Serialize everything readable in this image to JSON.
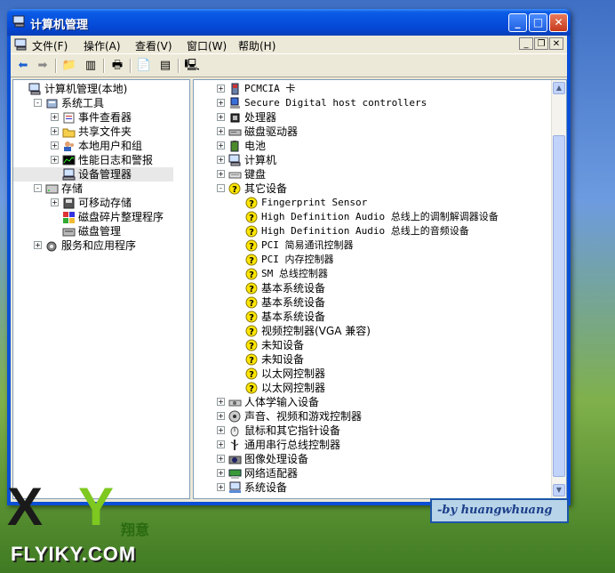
{
  "window": {
    "title": "计算机管理"
  },
  "menubar": [
    {
      "label": "文件(F)"
    },
    {
      "label": "操作(A)"
    },
    {
      "label": "查看(V)"
    },
    {
      "label": "窗口(W)"
    },
    {
      "label": "帮助(H)"
    }
  ],
  "left_tree": [
    {
      "label": "计算机管理(本地)",
      "level": 0,
      "expander": "",
      "icon": "computer-icon"
    },
    {
      "label": "系统工具",
      "level": 1,
      "expander": "-",
      "icon": "tools-icon"
    },
    {
      "label": "事件查看器",
      "level": 2,
      "expander": "+",
      "icon": "event-viewer-icon"
    },
    {
      "label": "共享文件夹",
      "level": 2,
      "expander": "+",
      "icon": "shared-folder-icon"
    },
    {
      "label": "本地用户和组",
      "level": 2,
      "expander": "+",
      "icon": "users-icon"
    },
    {
      "label": "性能日志和警报",
      "level": 2,
      "expander": "+",
      "icon": "performance-icon"
    },
    {
      "label": "设备管理器",
      "level": 2,
      "expander": "",
      "icon": "device-manager-icon",
      "selected": true
    },
    {
      "label": "存储",
      "level": 1,
      "expander": "-",
      "icon": "storage-icon"
    },
    {
      "label": "可移动存储",
      "level": 2,
      "expander": "+",
      "icon": "removable-storage-icon"
    },
    {
      "label": "磁盘碎片整理程序",
      "level": 2,
      "expander": "",
      "icon": "defrag-icon"
    },
    {
      "label": "磁盘管理",
      "level": 2,
      "expander": "",
      "icon": "disk-management-icon"
    },
    {
      "label": "服务和应用程序",
      "level": 1,
      "expander": "+",
      "icon": "services-icon"
    }
  ],
  "device_tree": [
    {
      "label": "PCMCIA 卡",
      "level": 0,
      "expander": "+",
      "icon": "pcmcia-icon"
    },
    {
      "label": "Secure Digital host controllers",
      "level": 0,
      "expander": "+",
      "icon": "sd-host-icon"
    },
    {
      "label": "处理器",
      "level": 0,
      "expander": "+",
      "icon": "processor-icon"
    },
    {
      "label": "磁盘驱动器",
      "level": 0,
      "expander": "+",
      "icon": "disk-drive-icon"
    },
    {
      "label": "电池",
      "level": 0,
      "expander": "+",
      "icon": "battery-icon"
    },
    {
      "label": "计算机",
      "level": 0,
      "expander": "+",
      "icon": "computer-icon"
    },
    {
      "label": "键盘",
      "level": 0,
      "expander": "+",
      "icon": "keyboard-icon"
    },
    {
      "label": "其它设备",
      "level": 0,
      "expander": "-",
      "icon": "unknown-device-icon"
    },
    {
      "label": "Fingerprint Sensor",
      "level": 1,
      "expander": "",
      "icon": "unknown-device-icon"
    },
    {
      "label": "High Definition Audio 总线上的调制解调器设备",
      "level": 1,
      "expander": "",
      "icon": "unknown-device-icon"
    },
    {
      "label": "High Definition Audio 总线上的音频设备",
      "level": 1,
      "expander": "",
      "icon": "unknown-device-icon"
    },
    {
      "label": "PCI 简易通讯控制器",
      "level": 1,
      "expander": "",
      "icon": "unknown-device-icon"
    },
    {
      "label": "PCI 内存控制器",
      "level": 1,
      "expander": "",
      "icon": "unknown-device-icon"
    },
    {
      "label": "SM 总线控制器",
      "level": 1,
      "expander": "",
      "icon": "unknown-device-icon"
    },
    {
      "label": "基本系统设备",
      "level": 1,
      "expander": "",
      "icon": "unknown-device-icon"
    },
    {
      "label": "基本系统设备",
      "level": 1,
      "expander": "",
      "icon": "unknown-device-icon"
    },
    {
      "label": "基本系统设备",
      "level": 1,
      "expander": "",
      "icon": "unknown-device-icon"
    },
    {
      "label": "视频控制器(VGA 兼容)",
      "level": 1,
      "expander": "",
      "icon": "unknown-device-icon"
    },
    {
      "label": "未知设备",
      "level": 1,
      "expander": "",
      "icon": "unknown-device-icon"
    },
    {
      "label": "未知设备",
      "level": 1,
      "expander": "",
      "icon": "unknown-device-icon"
    },
    {
      "label": "以太网控制器",
      "level": 1,
      "expander": "",
      "icon": "unknown-device-icon"
    },
    {
      "label": "以太网控制器",
      "level": 1,
      "expander": "",
      "icon": "unknown-device-icon"
    },
    {
      "label": "人体学输入设备",
      "level": 0,
      "expander": "+",
      "icon": "hid-icon"
    },
    {
      "label": "声音、视频和游戏控制器",
      "level": 0,
      "expander": "+",
      "icon": "sound-icon"
    },
    {
      "label": "鼠标和其它指针设备",
      "level": 0,
      "expander": "+",
      "icon": "mouse-icon"
    },
    {
      "label": "通用串行总线控制器",
      "level": 0,
      "expander": "+",
      "icon": "usb-icon"
    },
    {
      "label": "图像处理设备",
      "level": 0,
      "expander": "+",
      "icon": "imaging-icon"
    },
    {
      "label": "网络适配器",
      "level": 0,
      "expander": "+",
      "icon": "network-adapter-icon"
    },
    {
      "label": "系统设备",
      "level": 0,
      "expander": "+",
      "icon": "system-device-icon"
    }
  ],
  "overlay": {
    "signature": "-by huangwhuang",
    "logo_x": "X",
    "logo_y": "Y",
    "logo_cn": "翔意",
    "logo_url": "FLYIKY.COM"
  }
}
